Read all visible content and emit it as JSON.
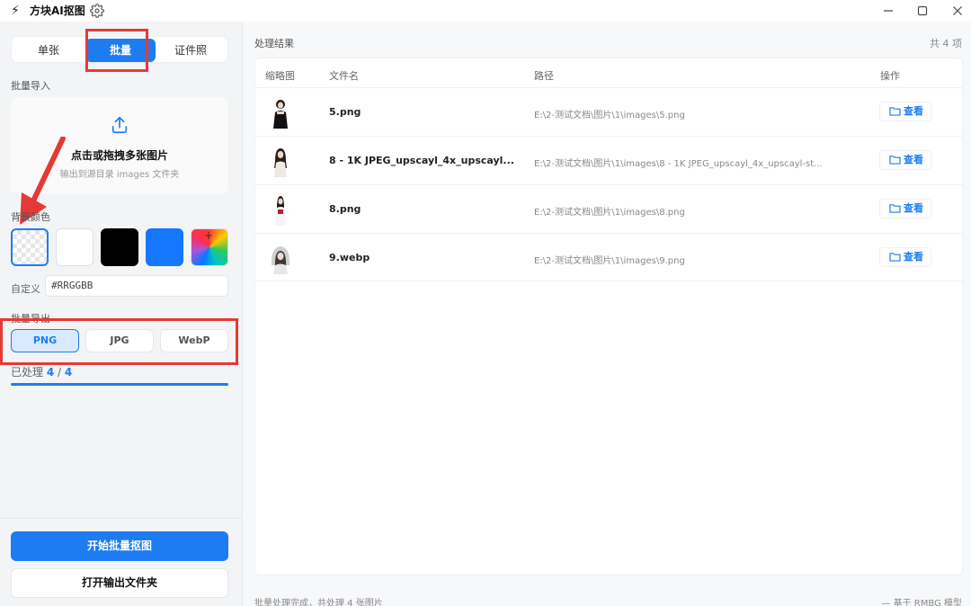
{
  "app": {
    "logo": "⚡",
    "title": "方块AI抠图"
  },
  "sidebar": {
    "tabs": [
      "单张",
      "批量",
      "证件照"
    ],
    "import_label": "批量导入",
    "dropzone": {
      "title": "点击或拖拽多张图片",
      "subtitle": "输出到源目录 images 文件夹"
    },
    "bg_label": "背景颜色",
    "bg_swatches": [
      {
        "name": "transparent",
        "color": "transparent"
      },
      {
        "name": "white",
        "color": "#ffffff"
      },
      {
        "name": "black",
        "color": "#000000"
      },
      {
        "name": "blue",
        "color": "#1677ff"
      },
      {
        "name": "custom",
        "color": "gradient"
      }
    ],
    "custom_plus": "+",
    "custom_label": "自定义",
    "custom_placeholder": "#RRGGBB",
    "export_label": "批量导出",
    "formats": [
      "PNG",
      "JPG",
      "WebP"
    ],
    "progress": {
      "label": "已处理",
      "done": "4",
      "separator": "/",
      "total": "4",
      "fraction": 1.0
    },
    "start_button": "开始批量抠图",
    "open_button": "打开输出文件夹"
  },
  "main": {
    "title": "处理结果",
    "count": "共 4 项",
    "columns": [
      "缩略图",
      "文件名",
      "路径",
      "操作"
    ],
    "rows": [
      {
        "name": "5.png",
        "path": "E:\\2-测试文档\\图片\\1\\images\\5.png",
        "action": "查看"
      },
      {
        "name": "8 - 1K JPEG_upscayl_4x_upscayl...",
        "path": "E:\\2-测试文档\\图片\\1\\images\\8 - 1K JPEG_upscayl_4x_upscayl-st...",
        "action": "查看"
      },
      {
        "name": "8.png",
        "path": "E:\\2-测试文档\\图片\\1\\images\\8.png",
        "action": "查看"
      },
      {
        "name": "9.webp",
        "path": "E:\\2-测试文档\\图片\\1\\images\\9.png",
        "action": "查看"
      }
    ]
  },
  "status": {
    "left": "批量处理完成，共处理 4 张图片",
    "right": "—    基于 RMBG 模型"
  },
  "colors": {
    "accent": "#1e7cf2",
    "annotation": "#e53935"
  }
}
